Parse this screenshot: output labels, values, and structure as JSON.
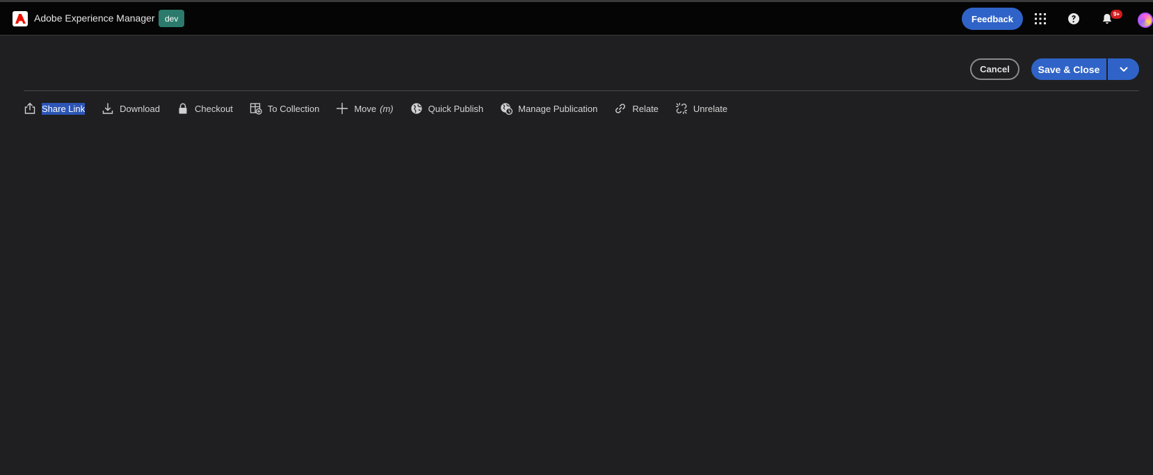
{
  "header": {
    "app_name": "Adobe Experience Manager",
    "environment": "dev",
    "feedback_label": "Feedback",
    "notification_count": "9+",
    "colors": {
      "shell_bg": "#050505",
      "accent": "#2f63c7",
      "env_badge": "#2b7a6c",
      "notification": "#d11d1d"
    }
  },
  "actions": {
    "cancel_label": "Cancel",
    "save_label": "Save & Close"
  },
  "toolbar": {
    "items": [
      {
        "label": "Share Link",
        "icon": "share-icon",
        "selected": true
      },
      {
        "label": "Download",
        "icon": "download-icon"
      },
      {
        "label": "Checkout",
        "icon": "lock-icon"
      },
      {
        "label": "To Collection",
        "icon": "collection-icon"
      },
      {
        "label": "Move",
        "shortcut": "(m)",
        "icon": "move-icon"
      },
      {
        "label": "Quick Publish",
        "icon": "globe-icon"
      },
      {
        "label": "Manage Publication",
        "icon": "globe-clock-icon"
      },
      {
        "label": "Relate",
        "icon": "link-icon"
      },
      {
        "label": "Unrelate",
        "icon": "unlink-icon"
      }
    ]
  },
  "icons": {
    "logo": "adobe-logo-icon",
    "apps": "apps-grid-icon",
    "help": "help-icon",
    "notifications": "bell-icon",
    "avatar": "user-avatar",
    "save_menu": "chevron-down-icon"
  }
}
